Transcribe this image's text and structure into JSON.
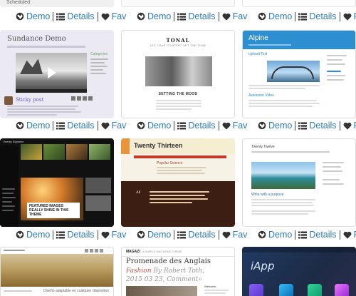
{
  "actions": {
    "demo": "Demo",
    "details": "Details",
    "fav": "Fav"
  },
  "colors": {
    "link": "#2e7bb8",
    "icon": "#333333"
  },
  "icons": [
    "globe-icon",
    "list-icon",
    "heart-icon"
  ],
  "cards": {
    "scheduled": {
      "status": "Scheduled"
    },
    "sundance": {
      "title": "Sundance Demo",
      "post_title": "Sticky post",
      "widget_title": "Categories"
    },
    "tonal": {
      "title": "TONAL",
      "tagline": "LET YOUR CONTENT SET THE TONE",
      "post_title": "SETTING THE MOOD"
    },
    "alpine": {
      "title": "Alpine",
      "post_title": "Upload Test",
      "post2_title": "Awesome Video"
    },
    "dark": {
      "title": "Twenty Eighteen",
      "caption": "FEATURED IMAGES REALLY SHINE IN THIS THEME"
    },
    "thirteen": {
      "title": "Twenty Thirteen",
      "post_title": "Popular Science"
    },
    "twelve": {
      "title": "Twenty Twelve",
      "post_title": "Write with a purpose"
    },
    "field": {
      "caption": "Diseño adaptable en cualquier dispositivo"
    },
    "magazine": {
      "brand": "MAGAZI",
      "tagline": "A SIMPLE MAGAZINE THEME",
      "headline": "Promenade des Anglais",
      "category": "Fashion",
      "byline": "By Robert Toth,",
      "date": "2015 03 23,",
      "comment": "Comment»",
      "sidebar": "Welcome"
    },
    "iapp": {
      "title": "iApp"
    }
  }
}
